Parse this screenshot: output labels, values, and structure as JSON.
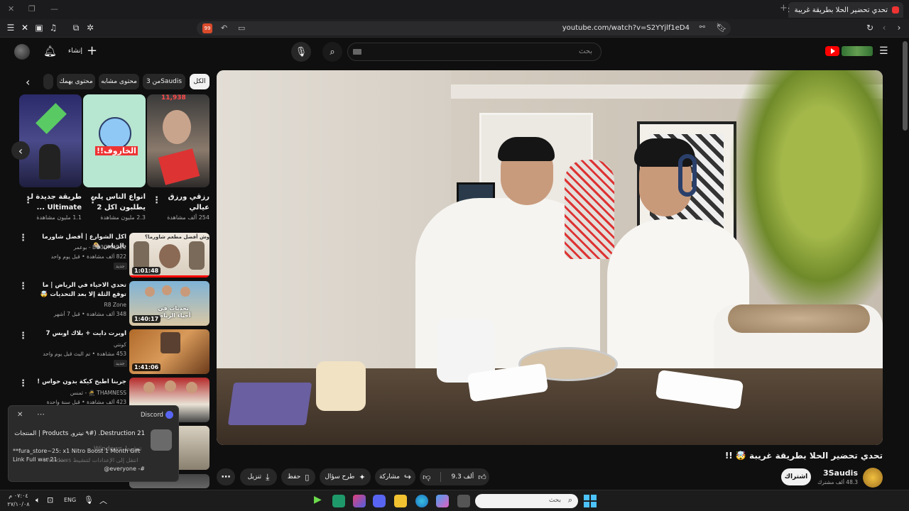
{
  "browser": {
    "tab_title": "تحدي تحضير الحلا بطريقة غريبة",
    "url": "youtube.com/watch?v=S2YYjlf1eD4",
    "ext_badge": "99"
  },
  "youtube": {
    "create_label": "إنشاء",
    "search_placeholder": "بحث",
    "chips": [
      "الكل",
      "من 3Saudis",
      "محتوى مشابه",
      "محتوى يهمك"
    ],
    "shorts": [
      {
        "title": "رزقي ورزق عيالي",
        "views": "254 ألف مشاهدة",
        "overlay": "11,938"
      },
      {
        "title": "انواع الناس يلي يطلبون اكل 2",
        "views": "2.3 مليون مشاهدة",
        "overlay": "الخاروف!!"
      },
      {
        "title": "طريقة جديدة لـ Ultimate ...",
        "views": "1.1 مليون مشاهدة",
        "overlay": ""
      }
    ],
    "videos": [
      {
        "title": "اكل الشوارع | أفضل شاورما بالرياض 🌯",
        "channel": "BO3OMAR22 - بوعمر",
        "meta": "822 ألف مشاهدة • قبل يوم واحد",
        "badge": "جديد",
        "duration": "1:01:48",
        "thumb_text": "وش أفضل مطعم شاورما؟"
      },
      {
        "title": "تحدي الاحياء في الرياض | ما توقع الثلة إلا بعد التحديات 🤯",
        "channel": "R8 Zone",
        "meta": "348 ألف مشاهدة • قبل 7 أشهر",
        "badge": "",
        "duration": "1:40:17",
        "thumb_text": "تحديات في أحياء الرياض"
      },
      {
        "title": "اوبرت دايت + بلاك اوبس 7",
        "channel": "كونتي",
        "meta": "453 مشاهدة • تم البث قبل يوم واحد",
        "badge": "جديد",
        "duration": "1:41:06",
        "thumb_text": ""
      },
      {
        "title": "جربنا اطبخ كيكة بدون حواس !",
        "channel": "THAMNESS 🥷 - ثمنس",
        "meta": "423 ألف مشاهدة • قبل سنة واحدة",
        "badge": "",
        "duration": "",
        "thumb_text": ""
      }
    ],
    "video": {
      "title": "تحدي تحضير الحلا بطريقة غريبة 🤯 !!",
      "channel": "3Saudis",
      "subscribers": "48.3 ألف مشترك",
      "subscribe_label": "اشتراك",
      "likes": "9.3 ألف",
      "share_label": "مشاركة",
      "ask_label": "طرح سؤال",
      "save_label": "حفظ",
      "download_label": "تنزيل"
    }
  },
  "discord_toast": {
    "app": "Discord",
    "line1": "21 Destruction. (#٩ نيترو, Products | المنتجات",
    "line2": "**fura_store~25:  x1 Nitro Boost 1 Month Gift Link Full war 21 ...",
    "line3": "@everyone -#",
    "ghost1": "تنشيط Windows",
    "ghost2": "انتقل إلى الإعدادات لتنشيط Windows."
  },
  "taskbar": {
    "lang": "ENG",
    "time": "٠٧:٠٤ م",
    "date": "٢٧/١٠/٠٨",
    "search_placeholder": "بحث"
  },
  "colors": {
    "yt_red": "#ff0000",
    "bg": "#0f0f0f",
    "chip": "#272727"
  }
}
